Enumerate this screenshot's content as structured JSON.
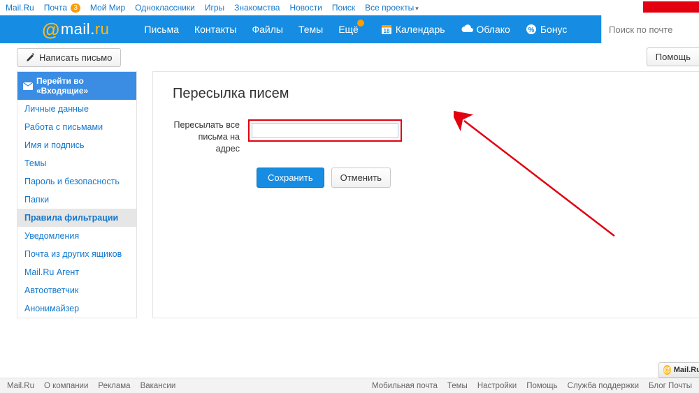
{
  "topnav": {
    "items": [
      {
        "label": "Mail.Ru"
      },
      {
        "label": "Почта",
        "badge": "3"
      },
      {
        "label": "Мой Мир"
      },
      {
        "label": "Одноклассники"
      },
      {
        "label": "Игры"
      },
      {
        "label": "Знакомства"
      },
      {
        "label": "Новости"
      },
      {
        "label": "Поиск"
      },
      {
        "label": "Все проекты",
        "caret": true
      }
    ]
  },
  "logo": {
    "at": "@",
    "name": "mail",
    "dot": ".",
    "tld": "ru"
  },
  "mainnav": {
    "letters": "Письма",
    "contacts": "Контакты",
    "files": "Файлы",
    "themes": "Темы",
    "more": "Ещё",
    "calendar": "Календарь",
    "cloud": "Облако",
    "bonus": "Бонус"
  },
  "search": {
    "placeholder": "Поиск по почте"
  },
  "toolbar": {
    "compose": "Написать письмо",
    "help": "Помощь"
  },
  "sidebar": {
    "header": "Перейти во «Входящие»",
    "items": [
      "Личные данные",
      "Работа с письмами",
      "Имя и подпись",
      "Темы",
      "Пароль и безопасность",
      "Папки",
      "Правила фильтрации",
      "Уведомления",
      "Почта из других ящиков",
      "Mail.Ru Агент",
      "Автоответчик",
      "Анонимайзер"
    ],
    "active_index": 6
  },
  "main": {
    "title": "Пересылка писем",
    "forward_label_line1": "Пересылать все",
    "forward_label_line2": "письма на адрес",
    "input_value": "",
    "save": "Сохранить",
    "cancel": "Отменить"
  },
  "agent_widget": "Mail.Ru А",
  "footer": {
    "left": [
      "Mail.Ru",
      "О компании",
      "Реклама",
      "Вакансии"
    ],
    "right": [
      "Мобильная почта",
      "Темы",
      "Настройки",
      "Помощь",
      "Служба поддержки",
      "Блог Почты"
    ]
  }
}
